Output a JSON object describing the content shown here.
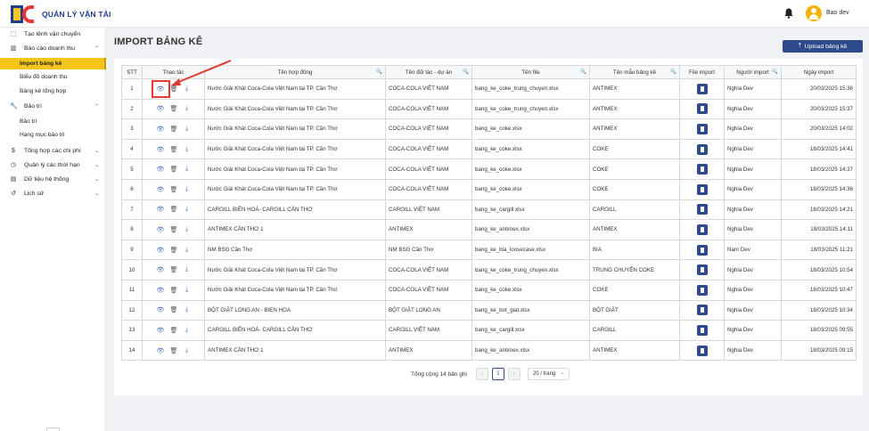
{
  "app": {
    "title": "QUẢN LÝ VẬN TẢI",
    "user": "Bao dev"
  },
  "sidebar": {
    "items": [
      {
        "label": "Tạo lệnh vận chuyển",
        "icon": "arrow-box-icon"
      },
      {
        "label": "Báo cáo doanh thu",
        "icon": "chart-icon",
        "expanded": true
      },
      {
        "label": "Import bảng kê",
        "sub": true,
        "active": true
      },
      {
        "label": "Biểu đồ doanh thu",
        "sub": true
      },
      {
        "label": "Bảng kê tổng hợp",
        "sub": true
      },
      {
        "label": "Bảo trì",
        "icon": "wrench-icon",
        "expanded": true
      },
      {
        "label": "Bảo trì",
        "sub": true
      },
      {
        "label": "Hạng mục bảo trì",
        "sub": true
      },
      {
        "label": "Tổng hợp các chi phí",
        "icon": "money-icon"
      },
      {
        "label": "Quản lý các thời hạn",
        "icon": "clock-icon"
      },
      {
        "label": "Dữ liệu hệ thống",
        "icon": "database-icon"
      },
      {
        "label": "Lịch sử",
        "icon": "history-icon"
      }
    ],
    "collapse_label": "◂"
  },
  "page": {
    "title": "IMPORT BẢNG KÊ",
    "upload_label": "Upload bảng kê"
  },
  "table": {
    "headers": [
      "STT",
      "Thao tác",
      "Tên hợp đồng",
      "Tên đối tác - dự án",
      "Tên file",
      "Tên mẫu bảng kê",
      "File import",
      "Người import",
      "Ngày import"
    ],
    "rows": [
      [
        "1",
        "Nước Giải Khát Coca-Cola Việt Nam tại TP. Cần Thơ",
        "COCA-COLA VIỆT NAM",
        "bang_ke_coke_trung_chuyen.xlsx",
        "ANTIMEX",
        "Nghia Dev",
        "20/03/2025 15:38"
      ],
      [
        "2",
        "Nước Giải Khát Coca-Cola Việt Nam tại TP. Cần Thơ",
        "COCA-COLA VIỆT NAM",
        "bang_ke_coke_trung_chuyen.xlsx",
        "ANTIMEX",
        "Nghia Dev",
        "20/03/2025 15:37"
      ],
      [
        "3",
        "Nước Giải Khát Coca-Cola Việt Nam tại TP. Cần Thơ",
        "COCA-COLA VIỆT NAM",
        "bang_ke_coke.xlsx",
        "ANTIMEX",
        "Nghia Dev",
        "20/03/2025 14:02"
      ],
      [
        "4",
        "Nước Giải Khát Coca-Cola Việt Nam tại TP. Cần Thơ",
        "COCA-COLA VIỆT NAM",
        "bang_ke_coke.xlsx",
        "COKE",
        "Nghia Dev",
        "18/03/2025 14:41"
      ],
      [
        "5",
        "Nước Giải Khát Coca-Cola Việt Nam tại TP. Cần Thơ",
        "COCA-COLA VIỆT NAM",
        "bang_ke_coke.xlsx",
        "COKE",
        "Nghia Dev",
        "18/03/2025 14:37"
      ],
      [
        "6",
        "Nước Giải Khát Coca-Cola Việt Nam tại TP. Cần Thơ",
        "COCA-COLA VIỆT NAM",
        "bang_ke_coke.xlsx",
        "COKE",
        "Nghia Dev",
        "18/03/2025 14:36"
      ],
      [
        "7",
        "CARGILL BIÊN HOÀ- CARGILL CẦN THƠ",
        "CARGILL VIỆT NAM",
        "bang_ke_cargill.xlsx",
        "CARGILL",
        "Nghia Dev",
        "18/03/2025 14:21"
      ],
      [
        "8",
        "ANTIMEX CẦN THƠ 1",
        "ANTIMEX",
        "bang_ke_antimex.xlsx",
        "ANTIMEX",
        "Nghia Dev",
        "18/03/2025 14:11"
      ],
      [
        "9",
        "NM BSG Cần Thơ",
        "NM BSG Cần Thơ",
        "bang_ke_bia_loosecase.xlsx",
        "BIA",
        "Nam Dev",
        "18/03/2025 11:21"
      ],
      [
        "10",
        "Nước Giải Khát Coca-Cola Việt Nam tại TP. Cần Thơ",
        "COCA-COLA VIỆT NAM",
        "bang_ke_coke_trung_chuyen.xlsx",
        "TRUNG CHUYỂN COKE",
        "Nghia Dev",
        "18/03/2025 10:54"
      ],
      [
        "11",
        "Nước Giải Khát Coca-Cola Việt Nam tại TP. Cần Thơ",
        "COCA-COLA VIỆT NAM",
        "bang_ke_coke.xlsx",
        "COKE",
        "Nghia Dev",
        "18/03/2025 10:47"
      ],
      [
        "12",
        "BỘT GIẶT LONG AN - BIEN HOA",
        "BỘT GIẶT LONG AN",
        "bang_ke_bot_giat.xlsx",
        "BỘT GIẶT",
        "Nghia Dev",
        "18/03/2025 10:34"
      ],
      [
        "13",
        "CARGILL BIÊN HOÀ- CARGILL CẦN THƠ",
        "CARGILL VIỆT NAM",
        "bang_ke_cargill.xlsx",
        "CARGILL",
        "Nghia Dev",
        "18/03/2025 09:55"
      ],
      [
        "14",
        "ANTIMEX CẦN THƠ 1",
        "ANTIMEX",
        "bang_ke_antimex.xlsx",
        "ANTIMEX",
        "Nghia Dev",
        "18/03/2025 09:15"
      ]
    ]
  },
  "pagination": {
    "total_label": "Tổng cộng 14 bản ghi",
    "prev": "‹",
    "current": "1",
    "next": "›",
    "page_size": "20 / trang"
  },
  "colors": {
    "accent": "#f5c518",
    "primary": "#2f4a8a",
    "annotation": "#e53935"
  }
}
